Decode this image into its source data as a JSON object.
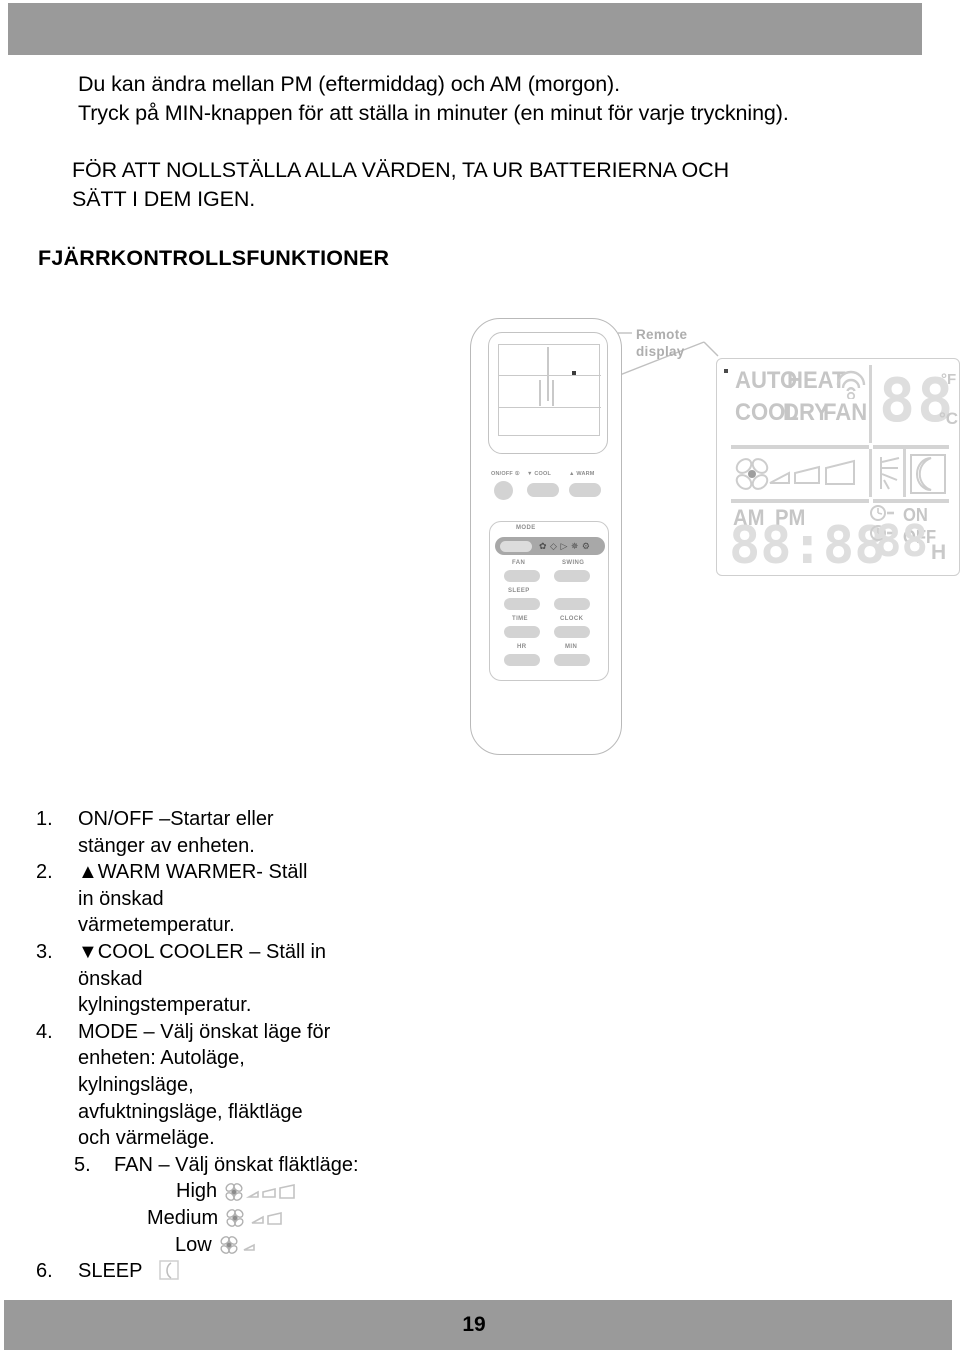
{
  "document": {
    "page_number": "19",
    "intro_lines": [
      "Du kan ändra mellan PM (eftermiddag) och AM (morgon).",
      "Tryck på MIN-knappen för att ställa in minuter (en minut för varje tryckning)."
    ],
    "caps_lines": [
      "FÖR ATT NOLLSTÄLLA ALLA VÄRDEN, TA UR BATTERIERNA OCH",
      "SÄTT I DEM IGEN."
    ],
    "section_heading": "FJÄRRKONTROLLSFUNKTIONER"
  },
  "figure": {
    "callout_label_line1": "Remote",
    "callout_label_line2": "display",
    "remote": {
      "top_buttons": [
        {
          "label": "ON/OFF ①",
          "shape": "circle"
        },
        {
          "label": "▼ COOL",
          "shape": "pill"
        },
        {
          "label": "▲ WARM",
          "shape": "pill"
        }
      ],
      "mode_label": "MODE",
      "mode_icons": "✿ ◇ ▷ ✵ ⚙",
      "pad_labels": [
        "FAN",
        "SWING",
        "SLEEP",
        "",
        "TIME",
        "CLOCK",
        "HR",
        "MIN"
      ]
    },
    "lcd": {
      "mode_row1": [
        "AUTO",
        "HEAT"
      ],
      "mode_row2": [
        "COOL",
        "DRY",
        "FAN"
      ],
      "temp_digits": "88",
      "temp_unit_f": "°F",
      "temp_unit_c": "°C",
      "fan_symbol": "fan-blade",
      "swing_symbol": "swing",
      "sleep_symbol": "moon",
      "am_label": "AM",
      "pm_label": "PM",
      "clock_digits": "88:88",
      "timer_on_label": "ON",
      "timer_off_label": "OFF",
      "hour_digits": "88",
      "hour_unit": "H"
    }
  },
  "instructions": [
    {
      "number": "1.",
      "lines": [
        "ON/OFF –Startar eller",
        "stänger av enheten."
      ]
    },
    {
      "number": "2.",
      "lines": [
        "▲WARM WARMER- Ställ",
        "in önskad",
        "värmetemperatur."
      ]
    },
    {
      "number": "3.",
      "lines": [
        "▼COOL COOLER – Ställ in",
        "önskad",
        "kylningstemperatur."
      ]
    },
    {
      "number": "4.",
      "lines": [
        "MODE – Välj önskat läge för",
        "enheten: Autoläge,",
        "kylningsläge,",
        "avfuktningsläge, fläktläge",
        "och värmeläge."
      ]
    },
    {
      "number": "5.",
      "lines": [
        "FAN – Välj önskat fläktläge:"
      ],
      "indent": true,
      "speeds": [
        {
          "label": "High",
          "icon": "fan-high"
        },
        {
          "label": "Medium",
          "icon": "fan-medium"
        },
        {
          "label": "Low",
          "icon": "fan-low"
        }
      ]
    },
    {
      "number": "6.",
      "lines": [
        "SLEEP"
      ],
      "icon": "moon-icon"
    }
  ],
  "colors": {
    "bar_gray": "#9a9a9a",
    "line_gray": "#c9c9c9",
    "lcd_gray": "#c6c6c6",
    "button_gray": "#d3d3d3",
    "text_black": "#000000"
  }
}
